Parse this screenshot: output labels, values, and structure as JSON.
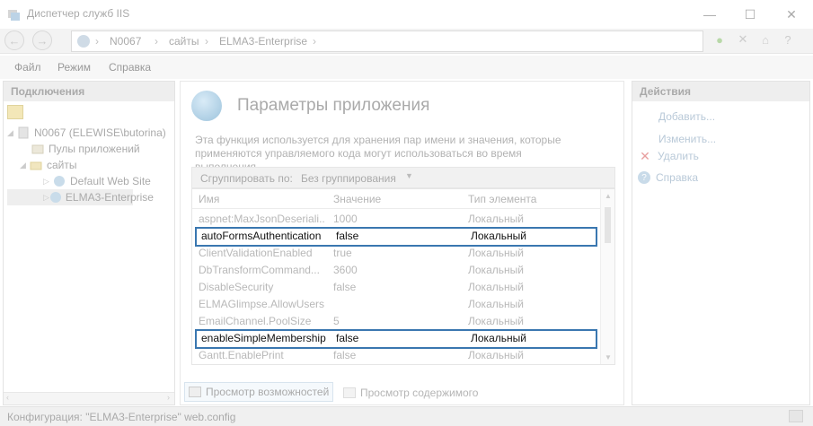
{
  "window": {
    "title": "Диспетчер служб IIS",
    "controls": {
      "minimize": "—",
      "maximize": "☐",
      "close": "✕"
    }
  },
  "address": {
    "segments": [
      "N0067",
      "сайты",
      "ELMA3-Enterprise"
    ],
    "separator": "›"
  },
  "menu": {
    "items": [
      "Файл",
      "Режим",
      "Справка"
    ]
  },
  "connections": {
    "title": "Подключения",
    "tree": [
      {
        "label": "N0067 (ELEWISE\\butorina)",
        "level": 0,
        "expanded": true,
        "icon": "server-icon"
      },
      {
        "label": "Пулы приложений",
        "level": 1,
        "icon": "app-pool-icon"
      },
      {
        "label": "сайты",
        "level": 1,
        "expanded": true,
        "icon": "sites-folder-icon"
      },
      {
        "label": "Default Web Site",
        "level": 2,
        "icon": "globe-icon"
      },
      {
        "label": "ELMA3-Enterprise",
        "level": 2,
        "selected": true,
        "icon": "globe-icon"
      }
    ]
  },
  "feature": {
    "title": "Параметры приложения",
    "description": "Эта функция используется для хранения пар имени и значения, которые применяются управляемого кода могут использоваться во время выполнения.",
    "group_by_label": "Сгруппировать по:",
    "group_by_value": "Без группирования",
    "columns": [
      "Имя",
      "Значение",
      "Тип элемента"
    ],
    "rows": [
      {
        "name": "aspnet:MaxJsonDeseriali...",
        "value": "1000",
        "type": "Локальный",
        "highlighted": false
      },
      {
        "name": "autoFormsAuthentication",
        "value": "false",
        "type": "Локальный",
        "highlighted": true
      },
      {
        "name": "ClientValidationEnabled",
        "value": "true",
        "type": "Локальный",
        "highlighted": false
      },
      {
        "name": "DbTransformCommand...",
        "value": "3600",
        "type": "Локальный",
        "highlighted": false
      },
      {
        "name": "DisableSecurity",
        "value": "false",
        "type": "Локальный",
        "highlighted": false
      },
      {
        "name": "ELMAGlimpse.AllowUsers",
        "value": "",
        "type": "Локальный",
        "highlighted": false
      },
      {
        "name": "EmailChannel.PoolSize",
        "value": "5",
        "type": "Локальный",
        "highlighted": false
      },
      {
        "name": "enableSimpleMembership",
        "value": "false",
        "type": "Локальный",
        "highlighted": true
      },
      {
        "name": "Gantt.EnablePrint",
        "value": "false",
        "type": "Локальный",
        "highlighted": false
      }
    ],
    "view_tabs": [
      "Просмотр возможностей",
      "Просмотр содержимого"
    ]
  },
  "actions": {
    "title": "Действия",
    "items": [
      {
        "label": "Добавить...",
        "icon": ""
      },
      {
        "label": "Изменить...",
        "icon": ""
      },
      {
        "label": "Удалить",
        "icon": "delete-x-icon"
      },
      {
        "label": "Справка",
        "icon": "help-icon"
      }
    ]
  },
  "status": {
    "text": "Конфигурация: \"ELMA3-Enterprise\" web.config"
  },
  "colors": {
    "highlight_border": "#3a77b0",
    "delete_red": "#e8a0a0",
    "link": "#b9c9d8"
  }
}
